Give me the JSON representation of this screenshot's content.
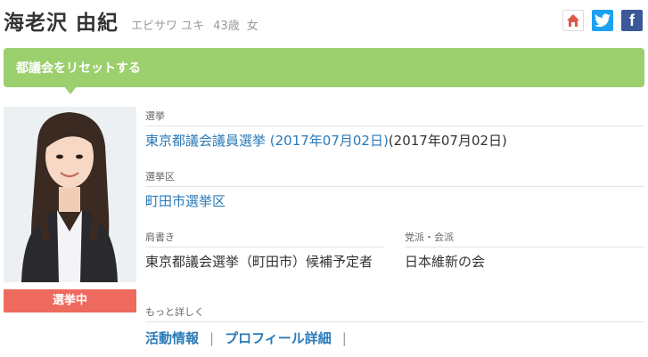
{
  "profile": {
    "name": "海老沢 由紀",
    "kana": "エビサワ ユキ",
    "age": "43歳",
    "sex": "女",
    "status_badge": "選挙中"
  },
  "social": {
    "home_icon": "home-icon",
    "twitter_icon": "twitter-icon",
    "facebook_icon": "facebook-icon",
    "facebook_glyph": "f"
  },
  "banner": {
    "label": "都議会をリセットする"
  },
  "fields": {
    "election_label": "選挙",
    "election_link": "東京都議会議員選挙 (2017年07月02日)",
    "election_date": "(2017年07月02日)",
    "district_label": "選挙区",
    "district_link": "町田市選挙区",
    "title_label": "肩書き",
    "title_value": "東京都議会選挙（町田市）候補予定者",
    "party_label": "党派・会派",
    "party_value": "日本維新の会",
    "more_label": "もっと詳しく"
  },
  "more_links": {
    "activity": "活動情報",
    "profile": "プロフィール詳細",
    "separator": "|"
  },
  "colors": {
    "banner": "#9ccf6d",
    "badge": "#ee6a5e",
    "link": "#2a7ab8",
    "twitter": "#1da1f2",
    "facebook": "#3b5998",
    "home": "#e0584c"
  }
}
